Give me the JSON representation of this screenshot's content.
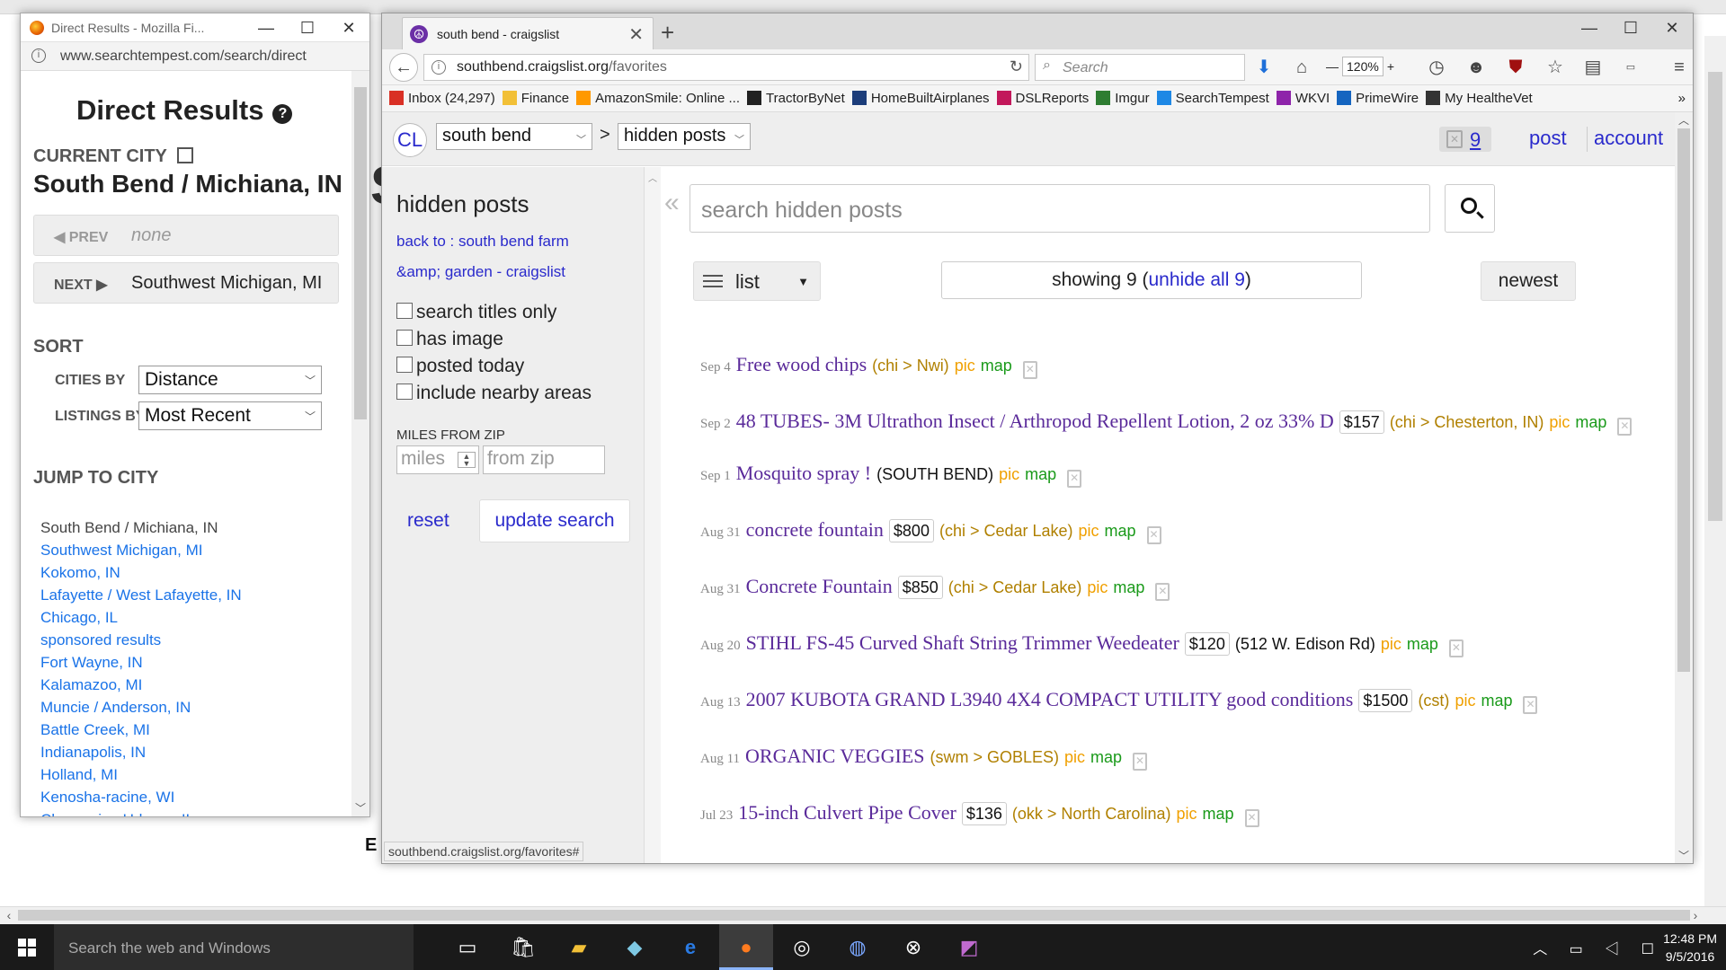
{
  "searchtempest": {
    "window_title": "Direct Results - Mozilla Fi...",
    "url": "www.searchtempest.com/search/direct",
    "heading": "Direct Results",
    "current_city_label": "CURRENT CITY",
    "current_city": "South Bend / Michiana, IN",
    "prev_label": "◀ PREV",
    "prev_value": "none",
    "next_label": "NEXT ▶",
    "next_value": "Southwest Michigan, MI",
    "sort_label": "SORT",
    "cities_by_label": "CITIES BY",
    "cities_by_value": "Distance",
    "listings_by_label": "LISTINGS BY",
    "listings_by_value": "Most Recent",
    "jump_label": "JUMP TO CITY",
    "jump_cities": [
      "South Bend / Michiana, IN",
      "Southwest Michigan, MI",
      "Kokomo, IN",
      "Lafayette / West Lafayette, IN",
      "Chicago, IL",
      "sponsored results",
      "Fort Wayne, IN",
      "Kalamazoo, MI",
      "Muncie / Anderson, IN",
      "Battle Creek, MI",
      "Indianapolis, IN",
      "Holland, MI",
      "Kenosha-racine, WI",
      "Champaign Urbana, IL"
    ]
  },
  "browser": {
    "tab_title": "south bend - craigslist",
    "url_host": "southbend.craigslist.org",
    "url_path": "/favorites",
    "search_placeholder": "Search",
    "zoom": "120%",
    "bookmarks": [
      {
        "label": "Inbox (24,297)",
        "color": "#d93025"
      },
      {
        "label": "Finance",
        "color": "#f2c037"
      },
      {
        "label": "AmazonSmile: Online ...",
        "color": "#ff9900"
      },
      {
        "label": "TractorByNet",
        "color": "#222222"
      },
      {
        "label": "HomeBuiltAirplanes",
        "color": "#1c3d7a"
      },
      {
        "label": "DSLReports",
        "color": "#c2185b"
      },
      {
        "label": "Imgur",
        "color": "#2e7d32"
      },
      {
        "label": "SearchTempest",
        "color": "#1e88e5"
      },
      {
        "label": "WKVI",
        "color": "#8e24aa"
      },
      {
        "label": "PrimeWire",
        "color": "#1565c0"
      },
      {
        "label": "My HealtheVet",
        "color": "#333333"
      }
    ],
    "status_url": "southbend.craigslist.org/favorites#"
  },
  "craigslist": {
    "logo": "CL",
    "area": "south bend",
    "section": "hidden posts",
    "hidden_count": "9",
    "post_link": "post",
    "account_link": "account",
    "filters": {
      "title": "hidden posts",
      "back_link": "back to : south bend farm &amp; garden - craigslist",
      "checkboxes": [
        "search titles only",
        "has image",
        "posted today",
        "include nearby areas"
      ],
      "miles_label": "MILES FROM ZIP",
      "miles_placeholder": "miles",
      "zip_placeholder": "from zip",
      "reset": "reset",
      "update": "update search"
    },
    "search_placeholder": "search hidden posts",
    "view_mode": "list",
    "showing_prefix": "showing 9 (",
    "unhide_all": "unhide all 9",
    "showing_suffix": ")",
    "sort": "newest",
    "listings": [
      {
        "date": "Sep 4",
        "title": "Free wood chips",
        "price": "",
        "hood": "(chi > Nwi)",
        "hood_plain": false,
        "pic": "pic",
        "map": "map"
      },
      {
        "date": "Sep 2",
        "title": "48 TUBES- 3M Ultrathon Insect / Arthropod Repellent Lotion, 2 oz 33% D",
        "price": "$157",
        "hood": "(chi > Chesterton, IN)",
        "hood_plain": false,
        "pic": "pic",
        "map": "map"
      },
      {
        "date": "Sep 1",
        "title": "Mosquito spray !",
        "price": "",
        "hood": "(SOUTH BEND)",
        "hood_plain": true,
        "pic": "pic",
        "map": "map"
      },
      {
        "date": "Aug 31",
        "title": "concrete fountain",
        "price": "$800",
        "hood": "(chi > Cedar Lake)",
        "hood_plain": false,
        "pic": "pic",
        "map": "map"
      },
      {
        "date": "Aug 31",
        "title": "Concrete Fountain",
        "price": "$850",
        "hood": "(chi > Cedar Lake)",
        "hood_plain": false,
        "pic": "pic",
        "map": "map"
      },
      {
        "date": "Aug 20",
        "title": "STIHL FS-45 Curved Shaft String Trimmer Weedeater",
        "price": "$120",
        "hood": "(512 W. Edison Rd)",
        "hood_plain": true,
        "pic": "pic",
        "map": "map"
      },
      {
        "date": "Aug 13",
        "title": "2007 KUBOTA GRAND L3940 4X4 COMPACT UTILITY good conditions",
        "price": "$1500",
        "hood": "(cst)",
        "hood_plain": false,
        "pic": "pic",
        "map": "map"
      },
      {
        "date": "Aug 11",
        "title": "ORGANIC VEGGIES",
        "price": "",
        "hood": "(swm > GOBLES)",
        "hood_plain": false,
        "pic": "pic",
        "map": "map"
      },
      {
        "date": "Jul 23",
        "title": "15-inch Culvert Pipe Cover",
        "price": "$136",
        "hood": "(okk > North Carolina)",
        "hood_plain": false,
        "pic": "pic",
        "map": "map"
      }
    ]
  },
  "taskbar": {
    "search_placeholder": "Search the web and Windows",
    "time": "12:48 PM",
    "date": "9/5/2016"
  }
}
